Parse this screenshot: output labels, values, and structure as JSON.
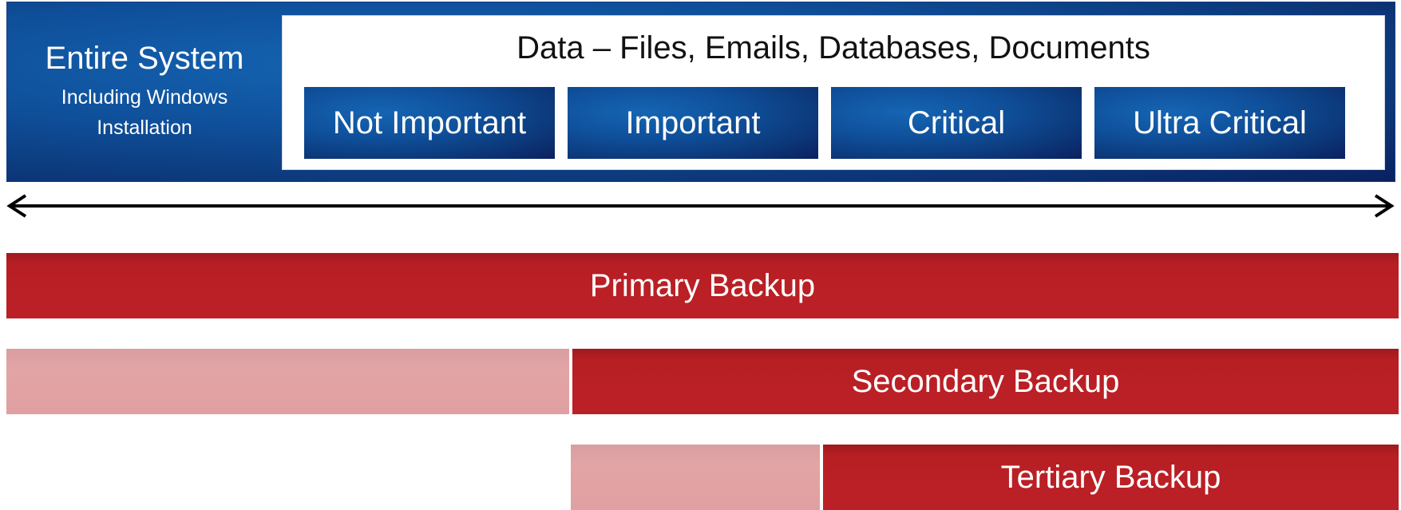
{
  "system": {
    "title": "Entire System",
    "subtitle_line1": "Including Windows",
    "subtitle_line2": "Installation"
  },
  "data": {
    "title": "Data – Files, Emails, Databases, Documents",
    "tiers": [
      "Not Important",
      "Important",
      "Critical",
      "Ultra Critical"
    ]
  },
  "backups": {
    "primary": "Primary Backup",
    "secondary": "Secondary Backup",
    "tertiary": "Tertiary Backup"
  },
  "colors": {
    "blue_panel": "#0f4f9a",
    "backup_red": "#bb2026",
    "excluded_pink": "#e3a4a6"
  }
}
